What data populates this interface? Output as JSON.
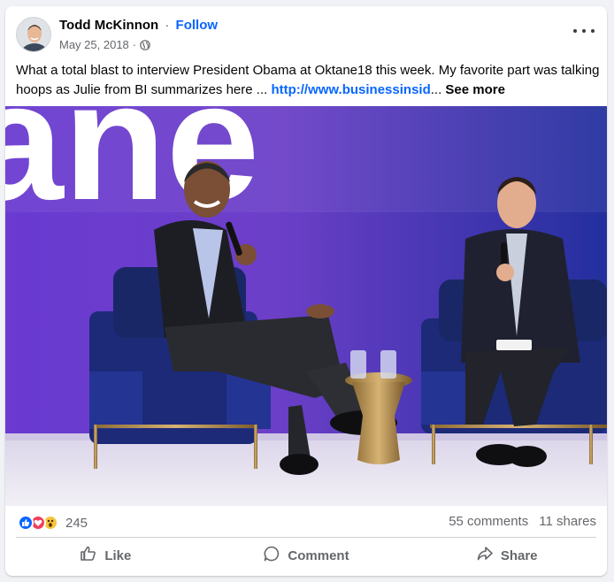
{
  "post": {
    "author": "Todd McKinnon",
    "separator": "·",
    "follow_label": "Follow",
    "date": "May 25, 2018",
    "date_separator": "·",
    "caption": "What a total blast to interview President Obama at Oktane18 this week.  My favorite part was talking hoops as Julie from BI summarizes here ... ",
    "link_text": "http://www.businessinsid",
    "ellipsis": "... ",
    "see_more": "See more"
  },
  "photo": {
    "backdrop_text": "ane"
  },
  "stats": {
    "reaction_count": "245",
    "comments": "55 comments",
    "shares": "11 shares"
  },
  "actions": {
    "like": "Like",
    "comment": "Comment",
    "share": "Share"
  },
  "colors": {
    "accent": "#0866ff",
    "backdrop_left": "#5a33c9",
    "backdrop_right": "#2b2f9a",
    "chair": "#1d2a72"
  },
  "icons": [
    "avatar",
    "globe-icon",
    "more-icon",
    "like-reaction-icon",
    "love-reaction-icon",
    "wow-reaction-icon",
    "like-icon",
    "comment-icon",
    "share-icon"
  ]
}
